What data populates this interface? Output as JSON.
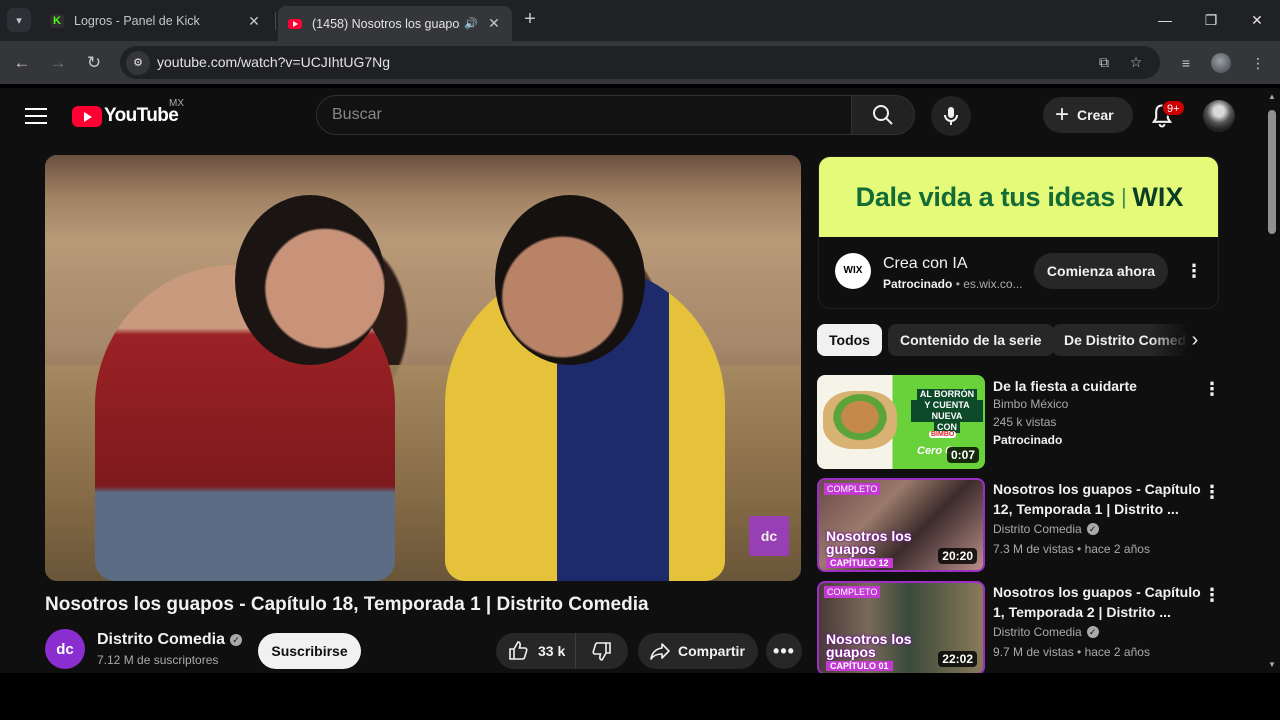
{
  "browser": {
    "tabs": [
      {
        "title": "Logros - Panel de Kick",
        "active": false
      },
      {
        "title": "(1458) Nosotros los guapos",
        "active": true
      }
    ],
    "url": "youtube.com/watch?v=UCJIhtUG7Ng"
  },
  "header": {
    "logo_text": "YouTube",
    "country": "MX",
    "search_placeholder": "Buscar",
    "create_label": "Crear",
    "notifications_badge": "9+"
  },
  "video": {
    "title": "Nosotros los guapos - Capítulo 18, Temporada 1 | Distrito Comedia",
    "channel": "Distrito Comedia",
    "subscribers": "7.12 M de suscriptores",
    "subscribe_label": "Suscribirse",
    "likes": "33 k",
    "share_label": "Compartir",
    "watermark": "dc"
  },
  "ad": {
    "banner_text": "Dale vida a tus ideas",
    "banner_brand": "WIX",
    "logo": "WIX",
    "title": "Crea con IA",
    "sponsored": "Patrocinado",
    "domain": "es.wix.co...",
    "cta": "Comienza ahora"
  },
  "chips": [
    {
      "label": "Todos",
      "selected": true
    },
    {
      "label": "Contenido de la serie",
      "selected": false
    },
    {
      "label": "De Distrito Comedia",
      "selected": false
    }
  ],
  "recommendations": [
    {
      "title": "De la fiesta a cuidarte",
      "channel": "Bimbo México",
      "meta": "245 k vistas",
      "extra": "Patrocinado",
      "duration": "0:07",
      "thumb_text_1": "AL BORRÓN",
      "thumb_text_2": "Y CUENTA NUEVA",
      "thumb_text_3": "CON",
      "thumb_brand": "BIMBO",
      "thumb_cero": "Cero C"
    },
    {
      "title": "Nosotros los guapos - Capítulo 12, Temporada 1 | Distrito ...",
      "channel": "Distrito Comedia",
      "meta": "7.3 M de vistas • hace 2 años",
      "duration": "20:20",
      "tag": "COMPLETO",
      "overlay_title": "Nosotros los guapos",
      "overlay_cap": "CAPÍTULO 12"
    },
    {
      "title": "Nosotros los guapos - Capítulo 1, Temporada 2 | Distrito ...",
      "channel": "Distrito Comedia",
      "meta": "9.7 M de vistas • hace 2 años",
      "duration": "22:02",
      "tag": "COMPLETO",
      "overlay_title": "Nosotros los guapos",
      "overlay_cap": "CAPÍTULO 01"
    }
  ],
  "colors": {
    "yt_red": "#ff0033",
    "page_bg": "#0f0f0f",
    "wix_banner": "#e6fa7a",
    "distrito_purple": "#9b2fc4"
  }
}
